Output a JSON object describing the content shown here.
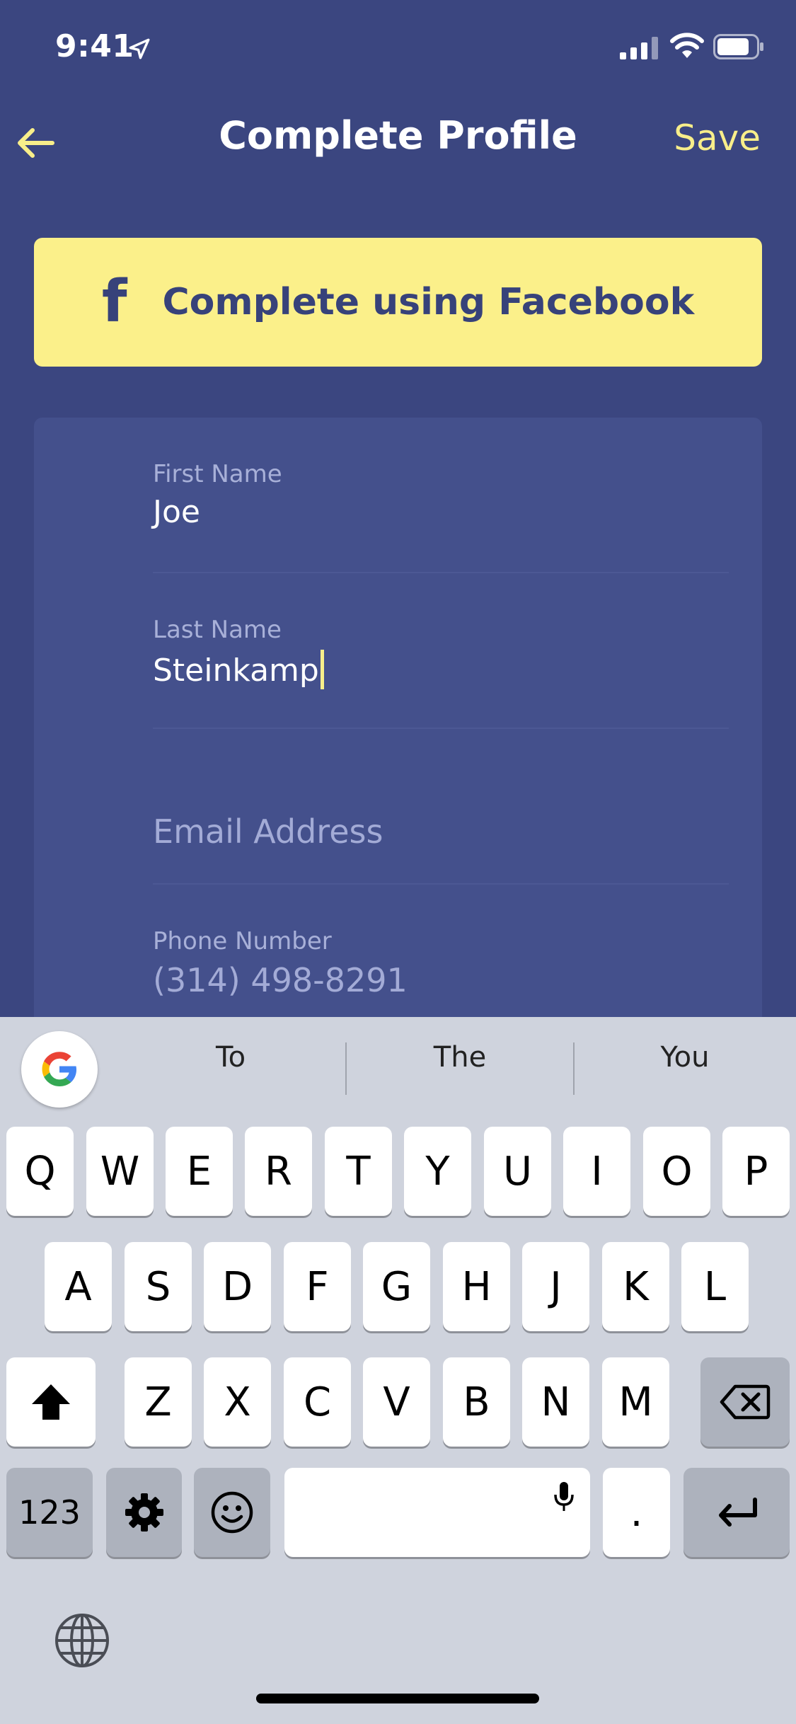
{
  "status_bar": {
    "time": "9:41"
  },
  "nav": {
    "title": "Complete Profile",
    "save_label": "Save"
  },
  "facebook_button": {
    "icon": "f",
    "label": "Complete using Facebook"
  },
  "form": {
    "first_name": {
      "label": "First Name",
      "value": "Joe"
    },
    "last_name": {
      "label": "Last Name",
      "value": "Steinkamp"
    },
    "email": {
      "placeholder": "Email Address"
    },
    "phone": {
      "label": "Phone Number",
      "value": "(314) 498-8291"
    }
  },
  "keyboard": {
    "suggestions": [
      "To",
      "The",
      "You"
    ],
    "row1": [
      "Q",
      "W",
      "E",
      "R",
      "T",
      "Y",
      "U",
      "I",
      "O",
      "P"
    ],
    "row2": [
      "A",
      "S",
      "D",
      "F",
      "G",
      "H",
      "J",
      "K",
      "L"
    ],
    "row3": [
      "Z",
      "X",
      "C",
      "V",
      "B",
      "N",
      "M"
    ],
    "numbers_key": "123",
    "period_key": "."
  },
  "colors": {
    "background": "#3b4680",
    "card": "#44508c",
    "accent_yellow": "#fbf08a",
    "keyboard_bg": "#cfd3dd"
  }
}
